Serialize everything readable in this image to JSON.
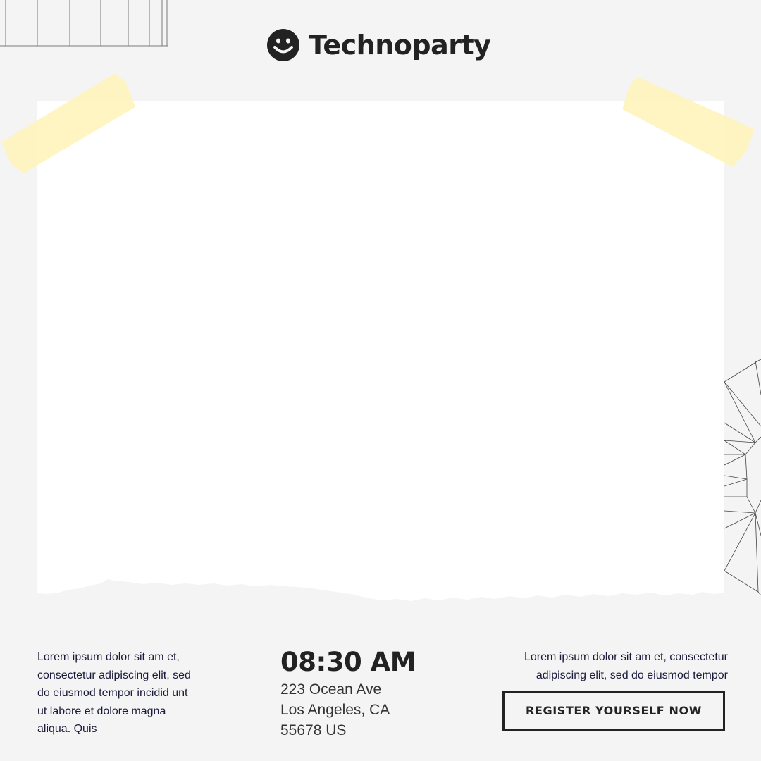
{
  "brand": {
    "name": "Technoparty",
    "logo_icon": "smiley-face-icon"
  },
  "decor": {
    "tape_color": "#fff3b8",
    "grid_icon": "grid-lines-icon",
    "sphere_icon": "wireframe-sphere-icon"
  },
  "info": {
    "left_text": "Lorem ipsum dolor sit am et, consectetur adipiscing elit, sed do eiusmod tempor incidid unt ut labore et dolore magna aliqua. Quis",
    "time": "08:30 AM",
    "address": {
      "street": "223 Ocean Ave",
      "city": "Los Angeles, CA",
      "zip": "55678 US"
    },
    "right_text": "Lorem ipsum dolor sit am et, consectetur adipiscing elit, sed do eiusmod tempor"
  },
  "cta": {
    "label": "REGISTER YOURSELF NOW"
  },
  "colors": {
    "background": "#f4f4f4",
    "text_dark": "#222222",
    "body_text": "#1a1a3a"
  }
}
